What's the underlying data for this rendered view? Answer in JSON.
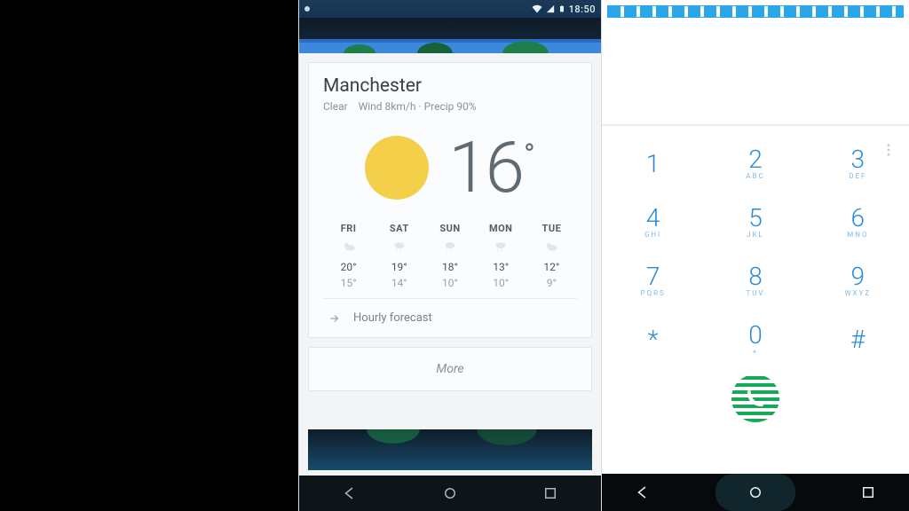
{
  "statusbar": {
    "time": "18:50"
  },
  "weather": {
    "city": "Manchester",
    "condition": "Clear",
    "wind": "Wind 8km/h",
    "precip": "Precip 90%",
    "temp": "16",
    "forecast": [
      {
        "day": "FRI",
        "hi": "20°",
        "lo": "15°"
      },
      {
        "day": "SAT",
        "hi": "19°",
        "lo": "14°"
      },
      {
        "day": "SUN",
        "hi": "18°",
        "lo": "10°"
      },
      {
        "day": "MON",
        "hi": "13°",
        "lo": "10°"
      },
      {
        "day": "TUE",
        "hi": "12°",
        "lo": "9°"
      }
    ],
    "hourly_label": "Hourly forecast",
    "more_label": "More"
  },
  "dialpad": {
    "keys": [
      [
        {
          "n": "1",
          "s": ""
        },
        {
          "n": "2",
          "s": "ABC"
        },
        {
          "n": "3",
          "s": "DEF"
        }
      ],
      [
        {
          "n": "4",
          "s": "GHI"
        },
        {
          "n": "5",
          "s": "JKL"
        },
        {
          "n": "6",
          "s": "MNO"
        }
      ],
      [
        {
          "n": "7",
          "s": "PQRS"
        },
        {
          "n": "8",
          "s": "TUV"
        },
        {
          "n": "9",
          "s": "WXYZ"
        }
      ],
      [
        {
          "n": "*",
          "s": ""
        },
        {
          "n": "0",
          "s": "+"
        },
        {
          "n": "#",
          "s": ""
        }
      ]
    ]
  }
}
